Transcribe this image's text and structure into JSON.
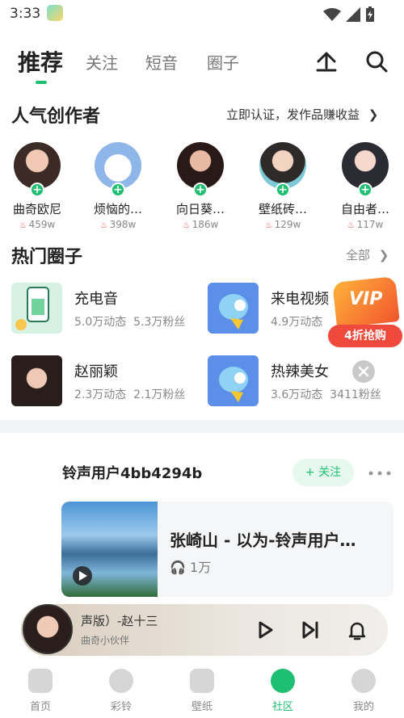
{
  "status_bar": {
    "time": "3:33"
  },
  "top_tabs": {
    "active": "推荐",
    "items": [
      "推荐",
      "关注",
      "短音",
      "圈子"
    ]
  },
  "creators_section": {
    "title": "人气创作者",
    "link": "立即认证，发作品赚收益",
    "creators": [
      {
        "name": "曲奇欧尼",
        "heat": "459w"
      },
      {
        "name": "烦恼的…",
        "heat": "398w"
      },
      {
        "name": "向日葵…",
        "heat": "186w"
      },
      {
        "name": "壁纸砖…",
        "heat": "129w"
      },
      {
        "name": "自由者…",
        "heat": "117w"
      }
    ]
  },
  "circles_section": {
    "title": "热门圈子",
    "link": "全部",
    "circles": [
      {
        "name": "充电音",
        "posts": "5.0万动态",
        "fans": "5.3万粉丝"
      },
      {
        "name": "来电视频",
        "posts": "4.9万动态",
        "fans": ""
      },
      {
        "name": "赵丽颖",
        "posts": "2.3万动态",
        "fans": "2.1万粉丝"
      },
      {
        "name": "热辣美女",
        "posts": "3.6万动态",
        "fans": "3411粉丝"
      }
    ]
  },
  "vip_promo": {
    "badge": "VIP",
    "label": "4折抢购"
  },
  "post": {
    "user": "铃声用户4bb4294b",
    "follow_label": "+ 关注",
    "song_title": "张崎山 - 以为-铃声用户…",
    "plays": "1万"
  },
  "player": {
    "title": "声版）-赵十三",
    "artist": "曲奇小伙伴"
  },
  "bottom_nav": {
    "active": "社区",
    "items": [
      "首页",
      "彩铃",
      "壁纸",
      "社区",
      "我的"
    ]
  }
}
